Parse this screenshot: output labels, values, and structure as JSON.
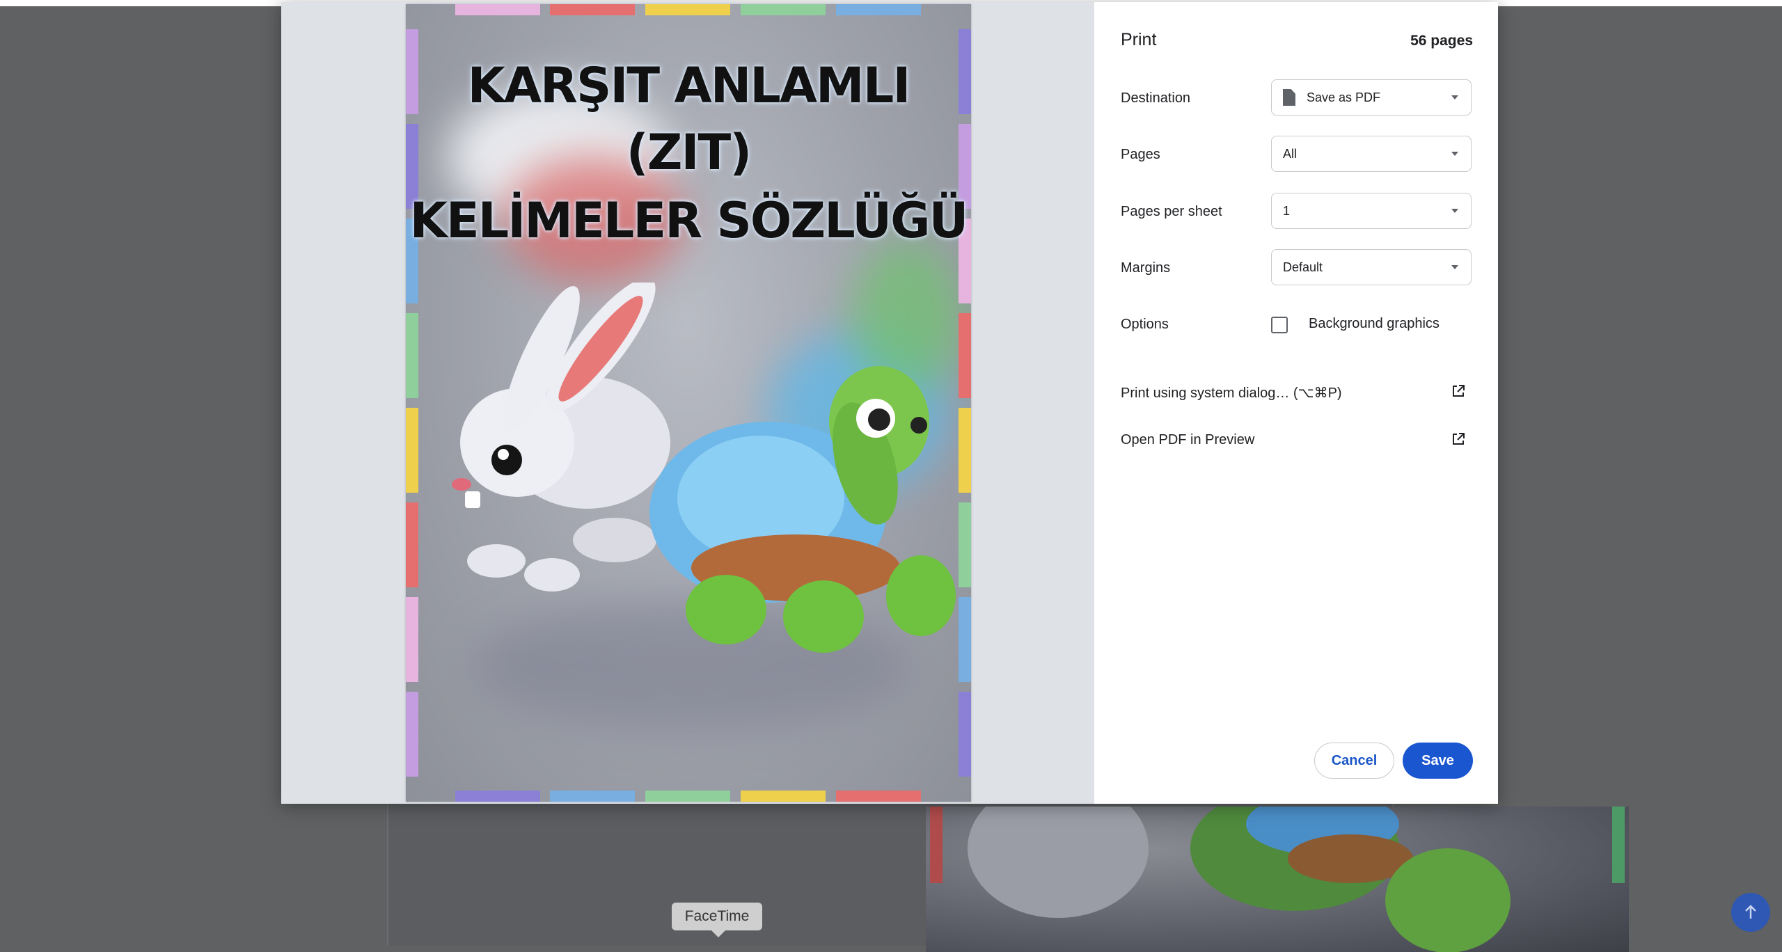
{
  "dialog": {
    "title": "Print",
    "page_count": "56 pages",
    "destination_label": "Destination",
    "destination_value": "Save as PDF",
    "pages_label": "Pages",
    "pages_value": "All",
    "pages_per_sheet_label": "Pages per sheet",
    "pages_per_sheet_value": "1",
    "margins_label": "Margins",
    "margins_value": "Default",
    "options_label": "Options",
    "background_graphics_label": "Background graphics",
    "system_dialog_label": "Print using system dialog… (⌥⌘P)",
    "open_pdf_label": "Open PDF in Preview",
    "cancel_label": "Cancel",
    "save_label": "Save",
    "accent_color": "#1b56d1"
  },
  "preview": {
    "title_line1": "KARŞIT ANLAMLI",
    "title_line2": "(ZIT)",
    "title_line3": "KELİMELER SÖZLÜĞÜ"
  },
  "dock": {
    "tooltip": "FaceTime"
  }
}
